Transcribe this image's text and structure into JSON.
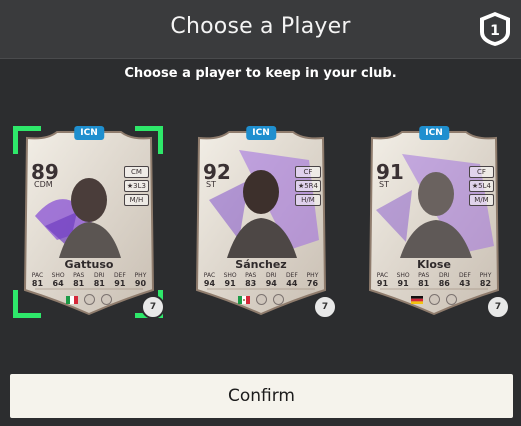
{
  "header": {
    "title": "Choose a Player",
    "badge_icon": "club-badge-icon"
  },
  "subtitle": "Choose a player to keep in your club.",
  "stat_keys": [
    "PAC",
    "SHO",
    "PAS",
    "DRI",
    "DEF",
    "PHY"
  ],
  "cards": [
    {
      "badge": "ICN",
      "rating": "89",
      "position": "CDM",
      "tags": [
        "CM",
        "★3L3",
        "M/H"
      ],
      "name": "Gattuso",
      "stats": [
        "81",
        "64",
        "81",
        "81",
        "91",
        "90"
      ],
      "nation": "Italy",
      "chemistry": "7",
      "selected": true
    },
    {
      "badge": "ICN",
      "rating": "92",
      "position": "ST",
      "tags": [
        "CF",
        "★5R4",
        "H/M"
      ],
      "name": "Sánchez",
      "stats": [
        "94",
        "91",
        "83",
        "94",
        "44",
        "76"
      ],
      "nation": "Mexico",
      "chemistry": "7",
      "selected": false
    },
    {
      "badge": "ICN",
      "rating": "91",
      "position": "ST",
      "tags": [
        "CF",
        "★5L4",
        "M/M"
      ],
      "name": "Klose",
      "stats": [
        "91",
        "91",
        "81",
        "86",
        "43",
        "82"
      ],
      "nation": "Germany",
      "chemistry": "7",
      "selected": false
    }
  ],
  "colors": {
    "selection": "#2ee86a",
    "accent_purple": "#8a52d6",
    "icn_badge": "#1f8fcf"
  },
  "confirm_label": "Confirm"
}
